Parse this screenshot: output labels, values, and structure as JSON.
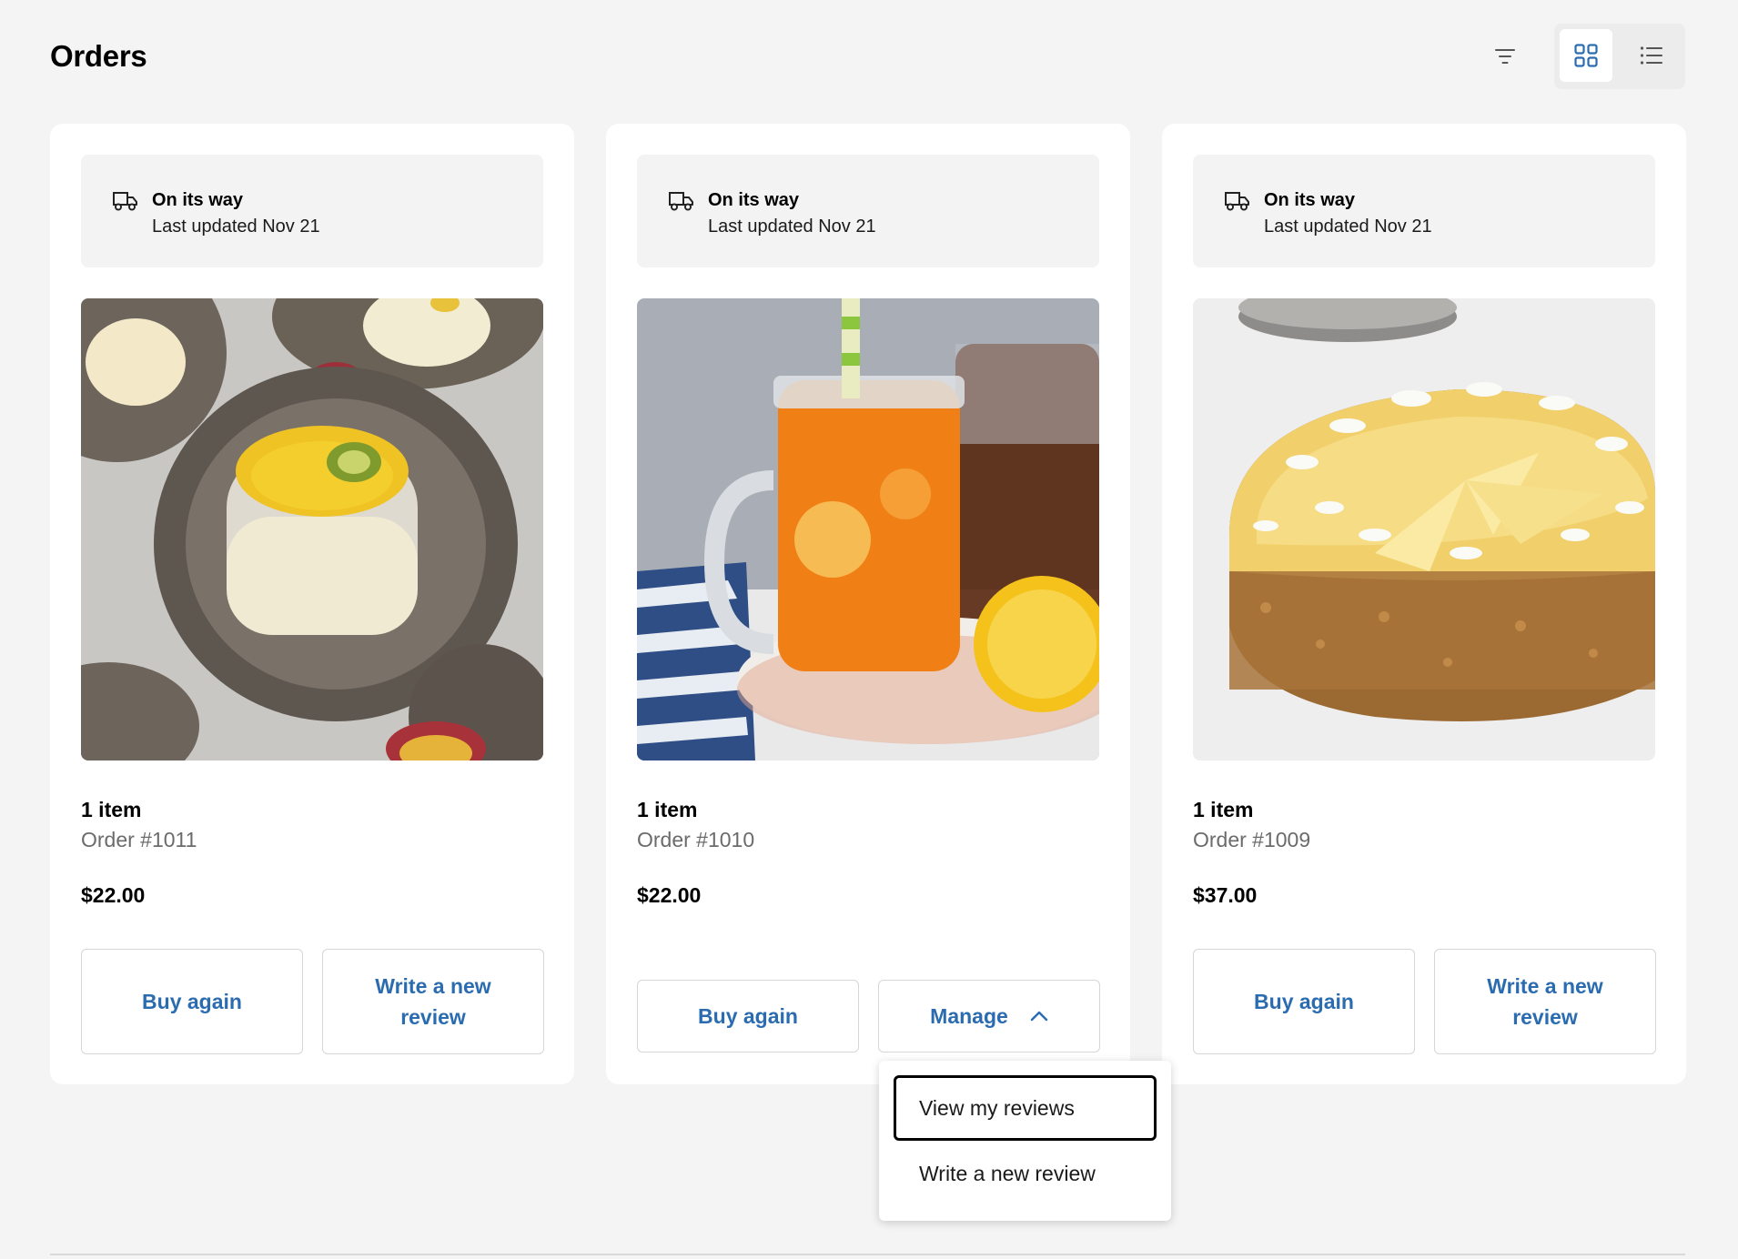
{
  "page": {
    "title": "Orders"
  },
  "toolbar": {
    "filter_icon": "filter-icon",
    "grid_view_icon": "grid-view-icon",
    "list_view_icon": "list-view-icon",
    "active_view": "grid",
    "accent": "#2b6cb0"
  },
  "orders": [
    {
      "status": "On its way",
      "updated": "Last updated Nov 21",
      "image": "passion fruit panna cotta dessert",
      "item_count": "1 item",
      "order_number": "Order #1011",
      "price": "$22.00",
      "buttons": [
        "Buy again",
        "Write a new review"
      ]
    },
    {
      "status": "On its way",
      "updated": "Last updated Nov 21",
      "image": "iced tea with lemon in mason jar",
      "item_count": "1 item",
      "order_number": "Order #1010",
      "price": "$22.00",
      "buttons": [
        "Buy again",
        "Manage"
      ]
    },
    {
      "status": "On its way",
      "updated": "Last updated Nov 21",
      "image": "white chocolate cheesecake",
      "item_count": "1 item",
      "order_number": "Order #1009",
      "price": "$37.00",
      "buttons": [
        "Buy again",
        "Write a new review"
      ]
    }
  ],
  "manage_menu": {
    "items": [
      "View my reviews",
      "Write a new review"
    ]
  }
}
